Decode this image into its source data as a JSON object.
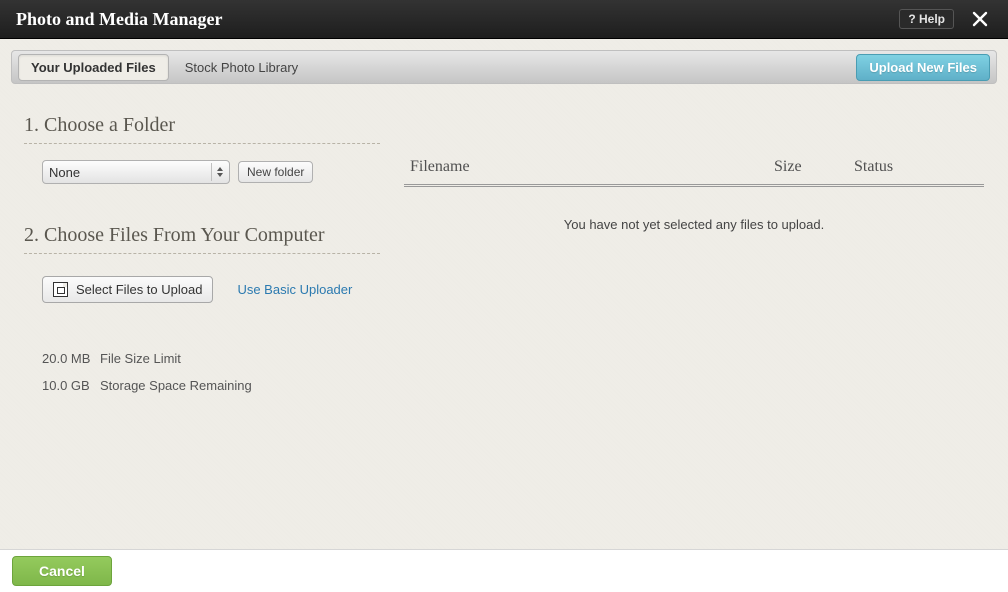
{
  "header": {
    "title": "Photo and Media Manager",
    "help_label": "?  Help"
  },
  "toolbar": {
    "tab_uploaded": "Your Uploaded Files",
    "tab_stock": "Stock Photo Library",
    "upload_button": "Upload New Files"
  },
  "section1": {
    "title": "1. Choose a Folder",
    "select_value": "None",
    "new_folder": "New folder"
  },
  "section2": {
    "title": "2. Choose Files From Your Computer",
    "select_files": "Select Files to Upload",
    "basic_uploader": "Use Basic Uploader"
  },
  "limits": {
    "size_value": "20.0 MB",
    "size_label": "File Size Limit",
    "space_value": "10.0 GB",
    "space_label": "Storage Space Remaining"
  },
  "table": {
    "col_filename": "Filename",
    "col_size": "Size",
    "col_status": "Status",
    "empty": "You have not yet selected any files to upload."
  },
  "footer": {
    "cancel": "Cancel"
  }
}
